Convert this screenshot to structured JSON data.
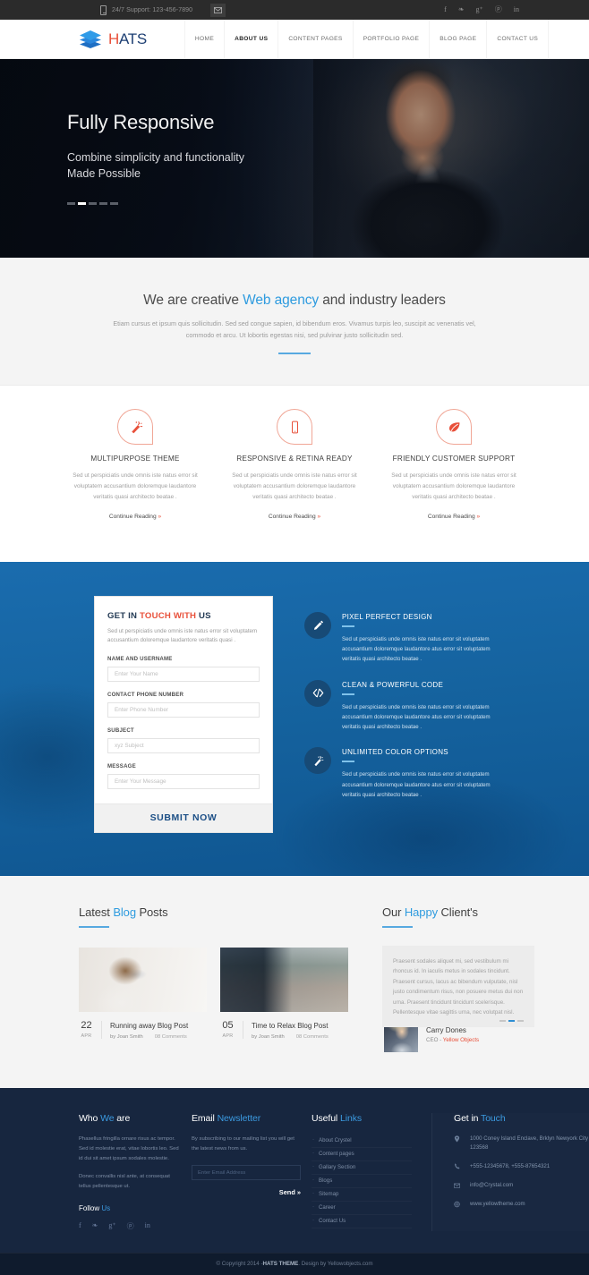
{
  "topbar": {
    "phone_icon": "mobile-phone-icon",
    "support_text": "24/7 Support: 123-456-7890",
    "mail_icon": "envelope-icon",
    "social": [
      {
        "name": "facebook-icon",
        "glyph": "f"
      },
      {
        "name": "twitter-icon",
        "glyph": "❧"
      },
      {
        "name": "google-plus-icon",
        "glyph": "g⁺"
      },
      {
        "name": "pinterest-icon",
        "glyph": "ⓟ"
      },
      {
        "name": "linkedin-icon",
        "glyph": "in"
      }
    ]
  },
  "header": {
    "logo": {
      "mark": "stacked-layers-icon",
      "first": "H",
      "rest": "ATS"
    },
    "nav": [
      {
        "label": "HOME",
        "active": false
      },
      {
        "label": "ABOUT US",
        "active": true
      },
      {
        "label": "CONTENT PAGES",
        "active": false
      },
      {
        "label": "PORTFOLIO PAGE",
        "active": false
      },
      {
        "label": "BLOG PAGE",
        "active": false
      },
      {
        "label": "CONTACT US",
        "active": false
      }
    ]
  },
  "hero": {
    "title": "Fully Responsive",
    "subtitle_line1": "Combine simplicity and functionality",
    "subtitle_line2": "Made Possible",
    "slides": 5,
    "active_slide": 2
  },
  "intro": {
    "heading_pre": "We are creative ",
    "heading_accent": "Web agency",
    "heading_post": " and industry leaders",
    "paragraph": "Etiam cursus et ipsum quis sollicitudin. Sed sed congue sapien, id bibendum eros. Vivamus turpis leo, suscipit ac venenatis vel, commodo et arcu. Ut lobortis egestas nisi, sed pulvinar justo sollicitudin sed."
  },
  "features": [
    {
      "icon": "magic-wand-icon",
      "title": "MULTIPURPOSE THEME",
      "text": "Sed ut perspiciatis unde omnis iste natus error sit voluptatem accusantium doloremque laudantore veritatis quasi architecto beatae .",
      "link": "Continue Reading",
      "link_arrow": "»"
    },
    {
      "icon": "mobile-device-icon",
      "title": "RESPONSIVE & RETINA READY",
      "text": "Sed ut perspiciatis unde omnis iste natus error sit voluptatem accusantium doloremque laudantore veritatis quasi architecto beatae .",
      "link": "Continue Reading",
      "link_arrow": "»"
    },
    {
      "icon": "leaf-icon",
      "title": "FRIENDLY CUSTOMER SUPPORT",
      "text": "Sed ut perspiciatis unde omnis iste natus error sit voluptatem accusantium doloremque laudantore veritatis quasi architecto beatae .",
      "link": "Continue Reading",
      "link_arrow": "»"
    }
  ],
  "contact_form": {
    "title_pre": "GET IN ",
    "title_accent": "TOUCH WITH",
    "title_post": " US",
    "intro": "Sed ut perspiciatis unde omnis iste natus error sit voluptatem accusantium doloremque laudantore veritatis quasi .",
    "fields": [
      {
        "label": "NAME AND USERNAME",
        "placeholder": "Enter Your Name",
        "value": ""
      },
      {
        "label": "CONTACT PHONE NUMBER",
        "placeholder": "Enter Phone Number",
        "value": ""
      },
      {
        "label": "SUBJECT",
        "placeholder": "xyz Subject",
        "value": ""
      },
      {
        "label": "MESSAGE",
        "placeholder": "Enter Your Message",
        "value": ""
      }
    ],
    "submit_label": "SUBMIT NOW"
  },
  "blue_features": [
    {
      "icon": "pencil-icon",
      "title": "PIXEL PERFECT DESIGN",
      "text": "Sed ut perspiciatis unde omnis iste natus error sit voluptatem accusantium doloremque laudantore atus error sit voluptatem veritatis quasi architecto beatae ."
    },
    {
      "icon": "code-brackets-icon",
      "title": "CLEAN & POWERFUL CODE",
      "text": "Sed ut perspiciatis unde omnis iste natus error sit voluptatem accusantium doloremque laudantore atus error sit voluptatem veritatis quasi architecto beatae ."
    },
    {
      "icon": "magic-wand-icon",
      "title": "UNLIMITED COLOR OPTIONS",
      "text": "Sed ut perspiciatis unde omnis iste natus error sit voluptatem accusantium doloremque laudantore atus error sit voluptatem veritatis quasi architecto beatae ."
    }
  ],
  "blog": {
    "title_pre": "Latest ",
    "title_accent": "Blog",
    "title_post": " Posts",
    "posts": [
      {
        "day": "22",
        "month": "APR",
        "title": "Running away Blog Post",
        "author": "by Joan Smith",
        "comments": "08 Comments"
      },
      {
        "day": "05",
        "month": "APR",
        "title": "Time to Relax Blog Post",
        "author": "by Joan Smith",
        "comments": "08 Comments"
      }
    ]
  },
  "testimonials": {
    "title_pre": "Our ",
    "title_accent": "Happy",
    "title_post": " Client's",
    "quote": "Praesent sodales aliquet mi, sed vestibulum mi rhoncus id. In iaculis metus in sodales tincidunt. Praesent cursus, lacus ac bibendum vulputate, nisl justo condimentum risus, non posuere metus dui non urna. Praesent tincidunt tincidunt scelerisque. Pellentesque vitae sagittis urna, nec volutpat nisl.",
    "name": "Carry Dones",
    "role_pre": "CEO - ",
    "role_accent": "Yellow Objects",
    "slides": 3,
    "active_slide": 2
  },
  "footer": {
    "who": {
      "title_pre": "Who ",
      "title_accent": "We",
      "title_post": " are",
      "p1": "Phasellus fringilla ornare risus ac tempor. Sed id molestie erat, vitae lobortis leo. Sed id dui sit amet ipsum sodales molestie.",
      "p2": "Donec convallis nisl ante, at consequat tellus pellentesque ut.",
      "follow_pre": "Follow ",
      "follow_accent": "Us",
      "social": [
        {
          "name": "facebook-icon",
          "glyph": "f"
        },
        {
          "name": "twitter-icon",
          "glyph": "❧"
        },
        {
          "name": "google-plus-icon",
          "glyph": "g⁺"
        },
        {
          "name": "pinterest-icon",
          "glyph": "ⓟ"
        },
        {
          "name": "linkedin-icon",
          "glyph": "in"
        }
      ]
    },
    "newsletter": {
      "title_pre": "Email ",
      "title_accent": "Newsletter",
      "text": "By subscribing to our mailing list you will get the latest news from us.",
      "placeholder": "Enter Email Address",
      "value": "",
      "send_label": "Send »"
    },
    "links": {
      "title_pre": "Useful ",
      "title_accent": "Links",
      "items": [
        "About Crystel",
        "Content pages",
        "Gallary Section",
        "Blogs",
        "Sitemap",
        "Career",
        "Contact Us"
      ]
    },
    "touch": {
      "title_pre": "Get in ",
      "title_accent": "Touch",
      "rows": [
        {
          "icon": "map-pin-icon",
          "text": "1000 Coney Island Enclave, Brklyn Newyork City 123568"
        },
        {
          "icon": "phone-icon",
          "text": "+555-12345678, +555-87654321"
        },
        {
          "icon": "envelope-icon",
          "text": "info@Crystal.com"
        },
        {
          "icon": "globe-icon",
          "text": "www.yellowtheme.com"
        }
      ]
    },
    "copyright_pre": "© Copyright 2014 - ",
    "copyright_brand": "HATS THEME",
    "copyright_post": ". Design by Yellowobjects.com"
  },
  "colors": {
    "accent_blue": "#2e9bdf",
    "accent_red": "#e8503a",
    "brand_navy": "#1d3f73",
    "section_blue": "#1565a8",
    "footer_navy": "#17263f"
  }
}
